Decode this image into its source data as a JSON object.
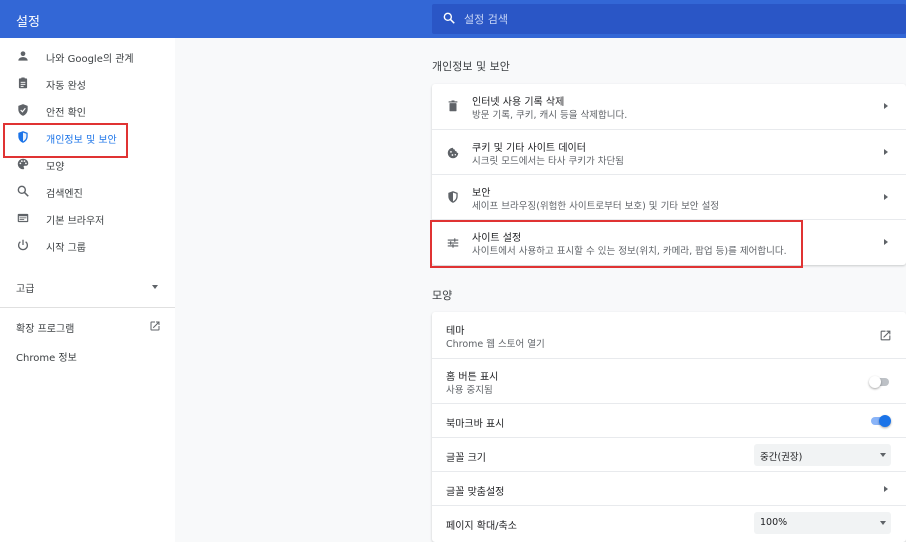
{
  "header": {
    "title": "설정",
    "search_placeholder": "설정 검색"
  },
  "sidebar": {
    "items": [
      {
        "label": "나와 Google의 관계",
        "icon": "person-icon"
      },
      {
        "label": "자동 완성",
        "icon": "clipboard-icon"
      },
      {
        "label": "안전 확인",
        "icon": "shield-check-icon"
      },
      {
        "label": "개인정보 및 보안",
        "icon": "shield-icon",
        "active": true
      },
      {
        "label": "모양",
        "icon": "palette-icon"
      },
      {
        "label": "검색엔진",
        "icon": "search-icon"
      },
      {
        "label": "기본 브라우저",
        "icon": "browser-icon"
      },
      {
        "label": "시작 그룹",
        "icon": "power-icon"
      }
    ],
    "advanced_label": "고급",
    "extensions_label": "확장 프로그램",
    "about_label": "Chrome 정보"
  },
  "privacy": {
    "section_title": "개인정보 및 보안",
    "rows": [
      {
        "title": "인터넷 사용 기록 삭제",
        "subtitle": "방문 기록, 쿠키, 캐시 등을 삭제합니다.",
        "icon": "trash-icon"
      },
      {
        "title": "쿠키 및 기타 사이트 데이터",
        "subtitle": "시크릿 모드에서는 타사 쿠키가 차단됨",
        "icon": "cookie-icon"
      },
      {
        "title": "보안",
        "subtitle": "세이프 브라우징(위험한 사이트로부터 보호) 및 기타 보안 설정",
        "icon": "security-shield-icon"
      },
      {
        "title": "사이트 설정",
        "subtitle": "사이트에서 사용하고 표시할 수 있는 정보(위치, 카메라, 팝업 등)를 제어합니다.",
        "icon": "tune-icon"
      }
    ]
  },
  "appearance": {
    "section_title": "모양",
    "theme_title": "테마",
    "theme_subtitle": "Chrome 웹 스토어 열기",
    "home_title": "홈 버튼 표시",
    "home_subtitle": "사용 중지됨",
    "home_enabled": false,
    "bookmarks_title": "북마크바 표시",
    "bookmarks_enabled": true,
    "font_size_title": "글꼴 크기",
    "font_size_value": "중간(권장)",
    "customize_fonts_title": "글꼴 맞춤설정",
    "zoom_title": "페이지 확대/축소",
    "zoom_value": "100%"
  },
  "colors": {
    "header": "#3367d6",
    "accent": "#1a73e8",
    "highlight": "#e03333"
  }
}
